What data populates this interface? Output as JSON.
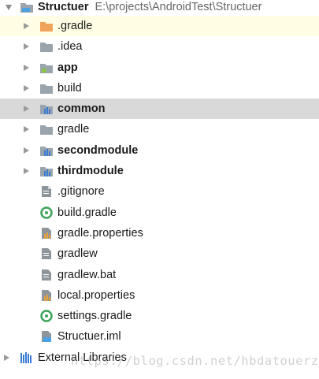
{
  "root": {
    "name": "Structuer",
    "path": "E:\\projects\\AndroidTest\\Structuer"
  },
  "items": [
    {
      "label": ".gradle"
    },
    {
      "label": ".idea"
    },
    {
      "label": "app"
    },
    {
      "label": "build"
    },
    {
      "label": "common"
    },
    {
      "label": "gradle"
    },
    {
      "label": "secondmodule"
    },
    {
      "label": "thirdmodule"
    },
    {
      "label": ".gitignore"
    },
    {
      "label": "build.gradle"
    },
    {
      "label": "gradle.properties"
    },
    {
      "label": "gradlew"
    },
    {
      "label": "gradlew.bat"
    },
    {
      "label": "local.properties"
    },
    {
      "label": "settings.gradle"
    },
    {
      "label": "Structuer.iml"
    }
  ],
  "external_libraries": {
    "label": "External Libraries"
  },
  "watermark": "https://blog.csdn.net/hbdatouerzi",
  "colors": {
    "selected_row": "#fffde3",
    "highlight_row": "#d9d9d9",
    "folder": "#9aa4ad",
    "folder_orange": "#f0a45b",
    "gradle_green": "#3fa35a"
  }
}
